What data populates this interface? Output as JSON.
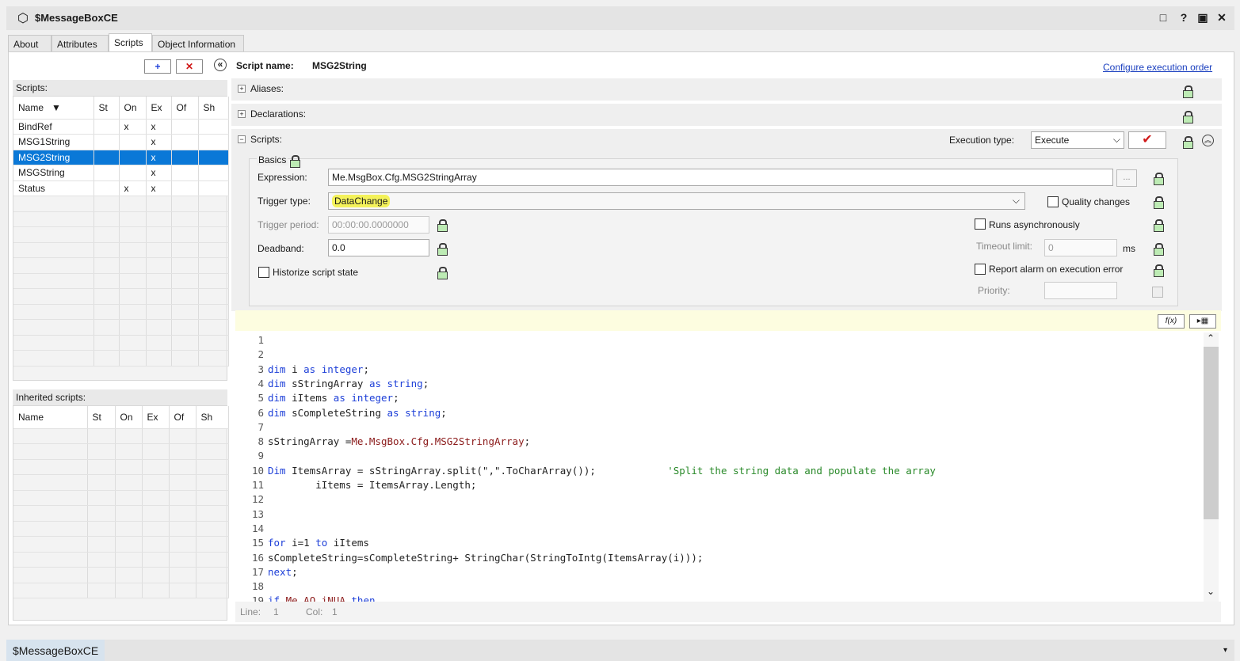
{
  "window": {
    "title": "$MessageBoxCE",
    "controls": [
      "□",
      "?",
      "▣",
      "✕"
    ]
  },
  "tabs": [
    "About",
    "Attributes",
    "Scripts",
    "Object Information"
  ],
  "left": {
    "add_label": "+",
    "delete_label": "✕",
    "collapse_label": "«",
    "scripts_label": "Scripts:",
    "columns": [
      "Name",
      "St",
      "On",
      "Ex",
      "Of",
      "Sh"
    ],
    "sort_indicator": "▼",
    "rows": [
      {
        "name": "BindRef",
        "st": "",
        "on": "x",
        "ex": "x",
        "of": "",
        "sh": ""
      },
      {
        "name": "MSG1String",
        "st": "",
        "on": "",
        "ex": "x",
        "of": "",
        "sh": ""
      },
      {
        "name": "MSG2String",
        "st": "",
        "on": "",
        "ex": "x",
        "of": "",
        "sh": ""
      },
      {
        "name": "MSGString",
        "st": "",
        "on": "",
        "ex": "x",
        "of": "",
        "sh": ""
      },
      {
        "name": "Status",
        "st": "",
        "on": "x",
        "ex": "x",
        "of": "",
        "sh": ""
      }
    ],
    "inherited_label": "Inherited scripts:",
    "inherited_columns": [
      "Name",
      "St",
      "On",
      "Ex",
      "Of",
      "Sh"
    ]
  },
  "right": {
    "script_name_label": "Script name:",
    "script_name": "MSG2String",
    "configure_link": "Configure execution order",
    "aliases_label": "Aliases:",
    "declarations_label": "Declarations:",
    "scripts_label": "Scripts:",
    "execution_type_label": "Execution type:",
    "execution_type": "Execute",
    "basics_label": "Basics",
    "expression_label": "Expression:",
    "expression_value": "Me.MsgBox.Cfg.MSG2StringArray",
    "ellipsis": "...",
    "trigger_type_label": "Trigger type:",
    "trigger_type": "DataChange",
    "quality_changes_label": "Quality changes",
    "trigger_period_label": "Trigger period:",
    "trigger_period": "00:00:00.0000000",
    "runs_async_label": "Runs asynchronously",
    "deadband_label": "Deadband:",
    "deadband": "0.0",
    "timeout_label": "Timeout limit:",
    "timeout": "0",
    "ms": "ms",
    "historize_label": "Historize script state",
    "report_alarm_label": "Report alarm on execution error",
    "priority_label": "Priority:",
    "priority": "",
    "fx_label": "f(x)",
    "line_label": "Line:",
    "line": "1",
    "col_label": "Col:",
    "col": "1"
  },
  "code_lines": [
    "",
    "",
    "dim i as integer;",
    "dim sStringArray as string;",
    "dim iItems as integer;",
    "dim sCompleteString as string;",
    "",
    "sStringArray =Me.MsgBox.Cfg.MSG2StringArray;",
    "",
    "Dim ItemsArray = sStringArray.split(\",\".ToCharArray());            'Split the string data and populate the array",
    "        iItems = ItemsArray.Length;",
    "",
    "",
    "",
    "for i=1 to iItems",
    "sCompleteString=sCompleteString+ StringChar(StringToIntg(ItemsArray(i)));",
    "next;",
    "",
    "if Me.AO.iNUA then"
  ],
  "bottom_tab": "$MessageBoxCE",
  "colors": {
    "selection": "#0a78d7",
    "highlight": "#f4f25a",
    "keyword": "#1d3fd8",
    "comment": "#2a8a2a",
    "member": "#8b1a1a"
  }
}
